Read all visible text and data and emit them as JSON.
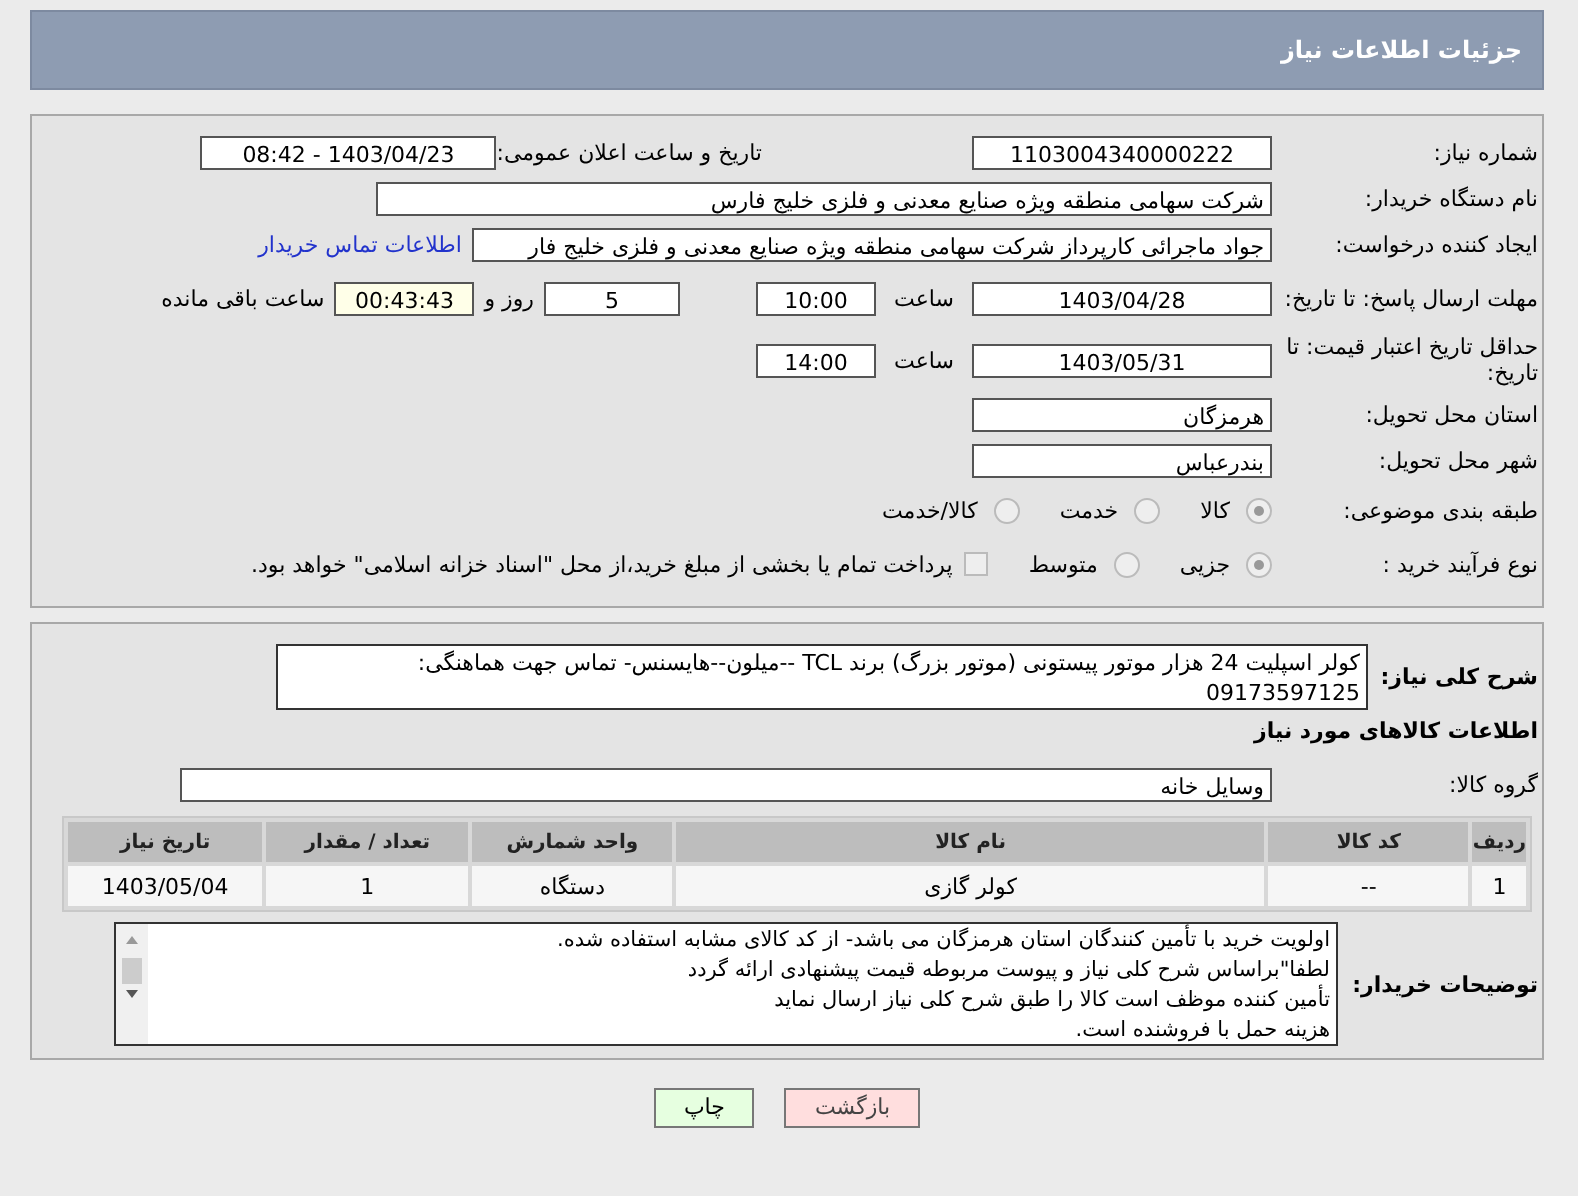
{
  "page_title": "جزئیات اطلاعات نیاز",
  "details": {
    "need_number": {
      "label": "شماره نیاز:",
      "value": "1103004340000222"
    },
    "announce": {
      "label": "تاریخ و ساعت اعلان عمومی:",
      "value": "1403/04/23 - 08:42"
    },
    "buyer": {
      "label": "نام دستگاه خریدار:",
      "value": "شرکت سهامی منطقه ویژه صنایع معدنی و فلزی خلیج فارس"
    },
    "requester": {
      "label": "ایجاد کننده درخواست:",
      "value": "جواد ماجرائی کارپرداز شرکت سهامی منطقه ویژه صنایع معدنی و فلزی خلیج فار",
      "link": "اطلاعات تماس خریدار"
    },
    "deadline": {
      "label": "مهلت ارسال پاسخ: تا تاریخ:",
      "date": "1403/04/28",
      "time_label": "ساعت",
      "time": "10:00",
      "days": "5",
      "days_label": "روز و",
      "remaining": "00:43:43",
      "remaining_label": "ساعت باقی مانده"
    },
    "validity": {
      "label": "حداقل تاریخ اعتبار قیمت: تا تاریخ:",
      "date": "1403/05/31",
      "time_label": "ساعت",
      "time": "14:00"
    },
    "province": {
      "label": "استان محل تحویل:",
      "value": "هرمزگان"
    },
    "city": {
      "label": "شهر محل تحویل:",
      "value": "بندرعباس"
    },
    "category": {
      "label": "طبقه بندی موضوعی:",
      "options": [
        {
          "label": "کالا",
          "selected": true
        },
        {
          "label": "خدمت",
          "selected": false
        },
        {
          "label": "کالا/خدمت",
          "selected": false
        }
      ]
    },
    "process": {
      "label": "نوع فرآیند خرید :",
      "options": [
        {
          "label": "جزیی",
          "selected": true
        },
        {
          "label": "متوسط",
          "selected": false
        }
      ],
      "payment": {
        "checked": false,
        "text": "پرداخت تمام یا بخشی از مبلغ خرید،از محل \"اسناد خزانه اسلامی\" خواهد بود."
      }
    }
  },
  "needs": {
    "description": {
      "label": "شرح کلی نیاز:",
      "value": "کولر اسپلیت 24 هزار موتور پیستونی (موتور بزرگ) برند TCL --میلون--هایسنس- تماس جهت هماهنگی: 09173597125"
    },
    "goods_title": "اطلاعات کالاهای مورد نیاز",
    "goods_group": {
      "label": "گروه کالا:",
      "value": "وسایل خانه"
    },
    "table": {
      "columns": [
        "ردیف",
        "کد کالا",
        "نام کالا",
        "واحد شمارش",
        "تعداد / مقدار",
        "تاریخ نیاز"
      ],
      "rows": [
        [
          "1",
          "--",
          "کولر گازی",
          "دستگاه",
          "1",
          "1403/05/04"
        ]
      ]
    },
    "buyer_notes": {
      "label": "توضیحات خریدار:",
      "lines": [
        "اولویت خرید با تأمین کنندگان استان هرمزگان می باشد- از کد کالای مشابه استفاده شده.",
        "لطفا\"براساس شرح کلی نیاز و پیوست مربوطه قیمت پیشنهادی ارائه گردد",
        "تأمین کننده موظف است کالا را طبق شرح کلی نیاز ارسال نماید",
        "هزینه حمل با فروشنده است."
      ]
    }
  },
  "buttons": [
    {
      "kind": "back",
      "label": "بازگشت"
    },
    {
      "kind": "print",
      "label": "چاپ"
    }
  ]
}
